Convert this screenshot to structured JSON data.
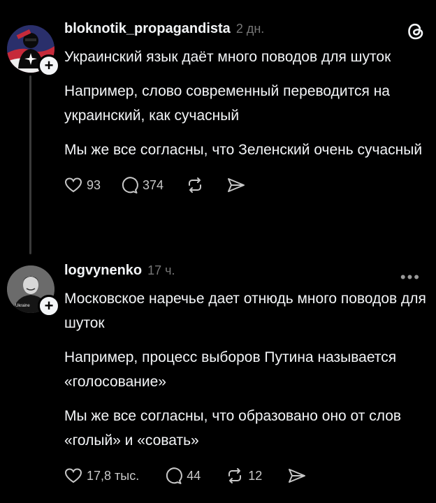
{
  "post1": {
    "username": "bloknotik_propagandista",
    "time": "2 дн.",
    "paragraphs": [
      "Украинский язык даёт много поводов для шуток",
      "Например, слово современный переводится на украинский, как сучасный",
      "Мы же все согласны, что Зеленский очень сучасный"
    ],
    "likes": "93",
    "comments": "374",
    "reposts": ""
  },
  "post2": {
    "username": "logvynenko",
    "time": "17 ч.",
    "paragraphs": [
      "Московское наречье дает отнюдь много поводов для шуток",
      "Например, процесс выборов Путина называется «голосование»",
      "Мы же все согласны, что образовано оно от слов «голый» и «совать»"
    ],
    "likes": "17,8 тыс.",
    "comments": "44",
    "reposts": "12"
  },
  "icons": {
    "app_logo": "threads-logo-icon",
    "like": "heart-icon",
    "comment": "comment-bubble-icon",
    "repost": "repost-icon",
    "share": "share-send-icon",
    "more": "more-options-icon"
  },
  "colors": {
    "background": "#000000",
    "text": "#f3f5f7",
    "muted": "#777777"
  }
}
